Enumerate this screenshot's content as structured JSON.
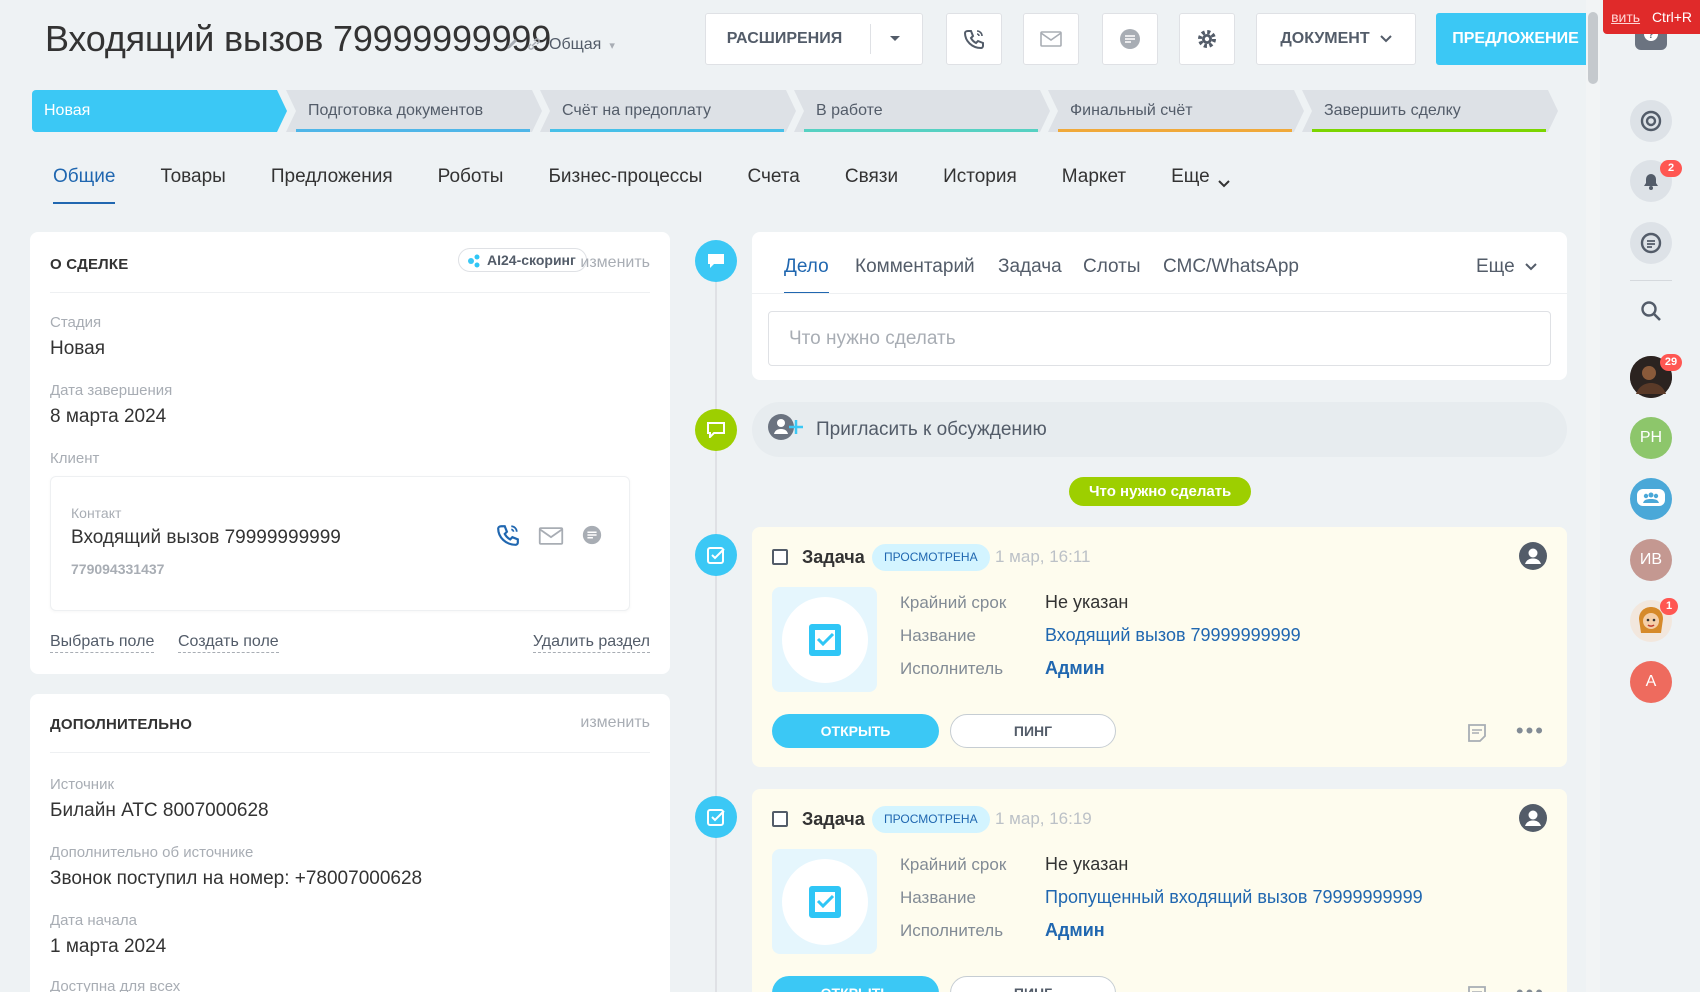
{
  "header": {
    "title": "Входящий вызов 79999999999",
    "category": "Общая",
    "extensions_label": "РАСШИРЕНИЯ",
    "document_label": "ДОКУМЕНТ",
    "proposal_label": "ПРЕДЛОЖЕНИЕ"
  },
  "stages": [
    {
      "label": "Новая",
      "color": "#3bc8f5"
    },
    {
      "label": "Подготовка документов",
      "color": "#4fb6e8"
    },
    {
      "label": "Счёт на предоплату",
      "color": "#47c0e8"
    },
    {
      "label": "В работе",
      "color": "#56d1c2"
    },
    {
      "label": "Финальный счёт",
      "color": "#f0a93a"
    },
    {
      "label": "Завершить сделку",
      "color": "#7bd500"
    }
  ],
  "tabs": [
    {
      "label": "Общие"
    },
    {
      "label": "Товары"
    },
    {
      "label": "Предложения"
    },
    {
      "label": "Роботы"
    },
    {
      "label": "Бизнес-процессы"
    },
    {
      "label": "Счета"
    },
    {
      "label": "Связи"
    },
    {
      "label": "История"
    },
    {
      "label": "Маркет"
    },
    {
      "label": "Еще"
    }
  ],
  "about": {
    "title": "О СДЕЛКЕ",
    "ai_chip": "AI24-скоринг",
    "edit": "изменить",
    "stage_label": "Стадия",
    "stage_value": "Новая",
    "close_label": "Дата завершения",
    "close_value": "8 марта 2024",
    "client_label": "Клиент",
    "contact_label": "Контакт",
    "contact_name": "Входящий вызов 79999999999",
    "contact_phone": "779094331437",
    "choose_field": "Выбрать поле",
    "create_field": "Создать поле",
    "delete_section": "Удалить раздел"
  },
  "extra": {
    "title": "ДОПОЛНИТЕЛЬНО",
    "edit": "изменить",
    "source_label": "Источник",
    "source_value": "Билайн АТС 8007000628",
    "source_info_label": "Дополнительно об источнике",
    "source_info_value": "Звонок поступил на номер: +78007000628",
    "start_label": "Дата начала",
    "start_value": "1 марта 2024",
    "available_label": "Доступна для всех"
  },
  "composer": {
    "tabs": [
      "Дело",
      "Комментарий",
      "Задача",
      "Слоты",
      "СМС/WhatsApp"
    ],
    "more": "Еще",
    "placeholder": "Что нужно сделать"
  },
  "invite": {
    "label": "Пригласить к обсуждению"
  },
  "todo_pill": "Что нужно сделать",
  "tasks": [
    {
      "title": "Задача",
      "badge": "просмотрена",
      "time": "1 мар, 16:11",
      "deadline_label": "Крайний срок",
      "deadline_value": "Не указан",
      "name_label": "Название",
      "name_value": "Входящий вызов 79999999999",
      "assignee_label": "Исполнитель",
      "assignee_value": "Админ",
      "open": "ОТКРЫТЬ",
      "ping": "ПИНГ"
    },
    {
      "title": "Задача",
      "badge": "просмотрена",
      "time": "1 мар, 16:19",
      "deadline_label": "Крайний срок",
      "deadline_value": "Не указан",
      "name_label": "Название",
      "name_value": "Пропущенный входящий вызов 79999999999",
      "assignee_label": "Исполнитель",
      "assignee_value": "Админ",
      "open": "ОТКРЫТЬ",
      "ping": "ПИНГ"
    }
  ],
  "sidebar": {
    "notifications_count": "2",
    "avatar1_count": "29",
    "avatar_ph": "РН",
    "avatar_iv": "ИВ",
    "avatar_a": "А",
    "avatar5_count": "1"
  },
  "corner": {
    "link": "вить",
    "shortcut": "Ctrl+R"
  }
}
